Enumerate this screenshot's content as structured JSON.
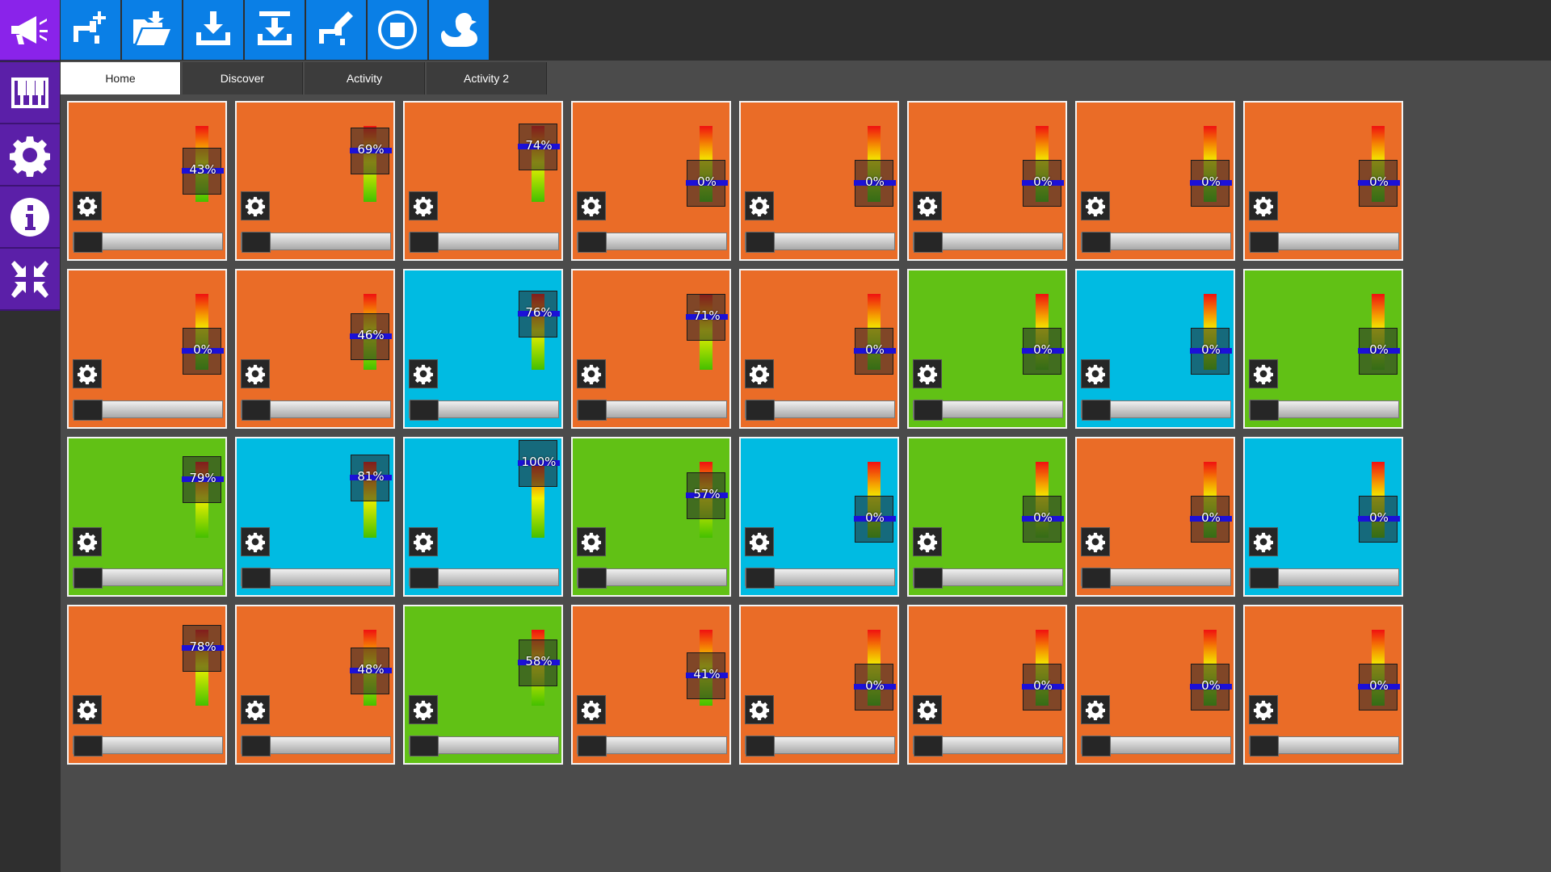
{
  "sidebar": {
    "items": [
      {
        "name": "announce-button",
        "icon": "megaphone-icon"
      },
      {
        "name": "piano-button",
        "icon": "piano-keys-icon"
      },
      {
        "name": "settings-button",
        "icon": "gear-icon"
      },
      {
        "name": "info-button",
        "icon": "info-icon"
      },
      {
        "name": "collapse-button",
        "icon": "arrows-inward-icon"
      }
    ]
  },
  "toolbar": {
    "buttons": [
      {
        "name": "add-button",
        "icon": "faucet-plus-icon"
      },
      {
        "name": "open-button",
        "icon": "folder-open-icon"
      },
      {
        "name": "download-button",
        "icon": "tray-download-icon"
      },
      {
        "name": "import-button",
        "icon": "tray-import-icon"
      },
      {
        "name": "edit-button",
        "icon": "faucet-pencil-icon"
      },
      {
        "name": "stop-button",
        "icon": "stop-circle-icon"
      },
      {
        "name": "duck-button",
        "icon": "duck-icon"
      }
    ]
  },
  "tabs": [
    {
      "label": "Home",
      "active": true
    },
    {
      "label": "Discover",
      "active": false
    },
    {
      "label": "Activity",
      "active": false
    },
    {
      "label": "Activity 2",
      "active": false
    }
  ],
  "colors": {
    "orange": "#ea6c27",
    "blue": "#00bbe2",
    "green": "#61c115",
    "purple": "#8a23ea",
    "toolbar_blue": "#0a7fe6"
  },
  "tiles": [
    {
      "color": "orange",
      "percent": "43%",
      "level": 0.43
    },
    {
      "color": "orange",
      "percent": "69%",
      "level": 0.69
    },
    {
      "color": "orange",
      "percent": "74%",
      "level": 0.74
    },
    {
      "color": "orange",
      "percent": "0%",
      "level": 0
    },
    {
      "color": "orange",
      "percent": "0%",
      "level": 0
    },
    {
      "color": "orange",
      "percent": "0%",
      "level": 0
    },
    {
      "color": "orange",
      "percent": "0%",
      "level": 0
    },
    {
      "color": "orange",
      "percent": "0%",
      "level": 0
    },
    {
      "color": "orange",
      "percent": "0%",
      "level": 0
    },
    {
      "color": "orange",
      "percent": "46%",
      "level": 0.46
    },
    {
      "color": "blue",
      "percent": "76%",
      "level": 0.76
    },
    {
      "color": "orange",
      "percent": "71%",
      "level": 0.71
    },
    {
      "color": "orange",
      "percent": "0%",
      "level": 0
    },
    {
      "color": "green",
      "percent": "0%",
      "level": 0
    },
    {
      "color": "blue",
      "percent": "0%",
      "level": 0
    },
    {
      "color": "green",
      "percent": "0%",
      "level": 0
    },
    {
      "color": "green",
      "percent": "79%",
      "level": 0.79
    },
    {
      "color": "blue",
      "percent": "81%",
      "level": 0.81
    },
    {
      "color": "blue",
      "percent": "100%",
      "level": 1.0
    },
    {
      "color": "green",
      "percent": "57%",
      "level": 0.57
    },
    {
      "color": "blue",
      "percent": "0%",
      "level": 0
    },
    {
      "color": "green",
      "percent": "0%",
      "level": 0
    },
    {
      "color": "orange",
      "percent": "0%",
      "level": 0
    },
    {
      "color": "blue",
      "percent": "0%",
      "level": 0
    },
    {
      "color": "orange",
      "percent": "78%",
      "level": 0.78
    },
    {
      "color": "orange",
      "percent": "48%",
      "level": 0.48
    },
    {
      "color": "green",
      "percent": "58%",
      "level": 0.58
    },
    {
      "color": "orange",
      "percent": "41%",
      "level": 0.41
    },
    {
      "color": "orange",
      "percent": "0%",
      "level": 0
    },
    {
      "color": "orange",
      "percent": "0%",
      "level": 0
    },
    {
      "color": "orange",
      "percent": "0%",
      "level": 0
    },
    {
      "color": "orange",
      "percent": "0%",
      "level": 0
    }
  ]
}
